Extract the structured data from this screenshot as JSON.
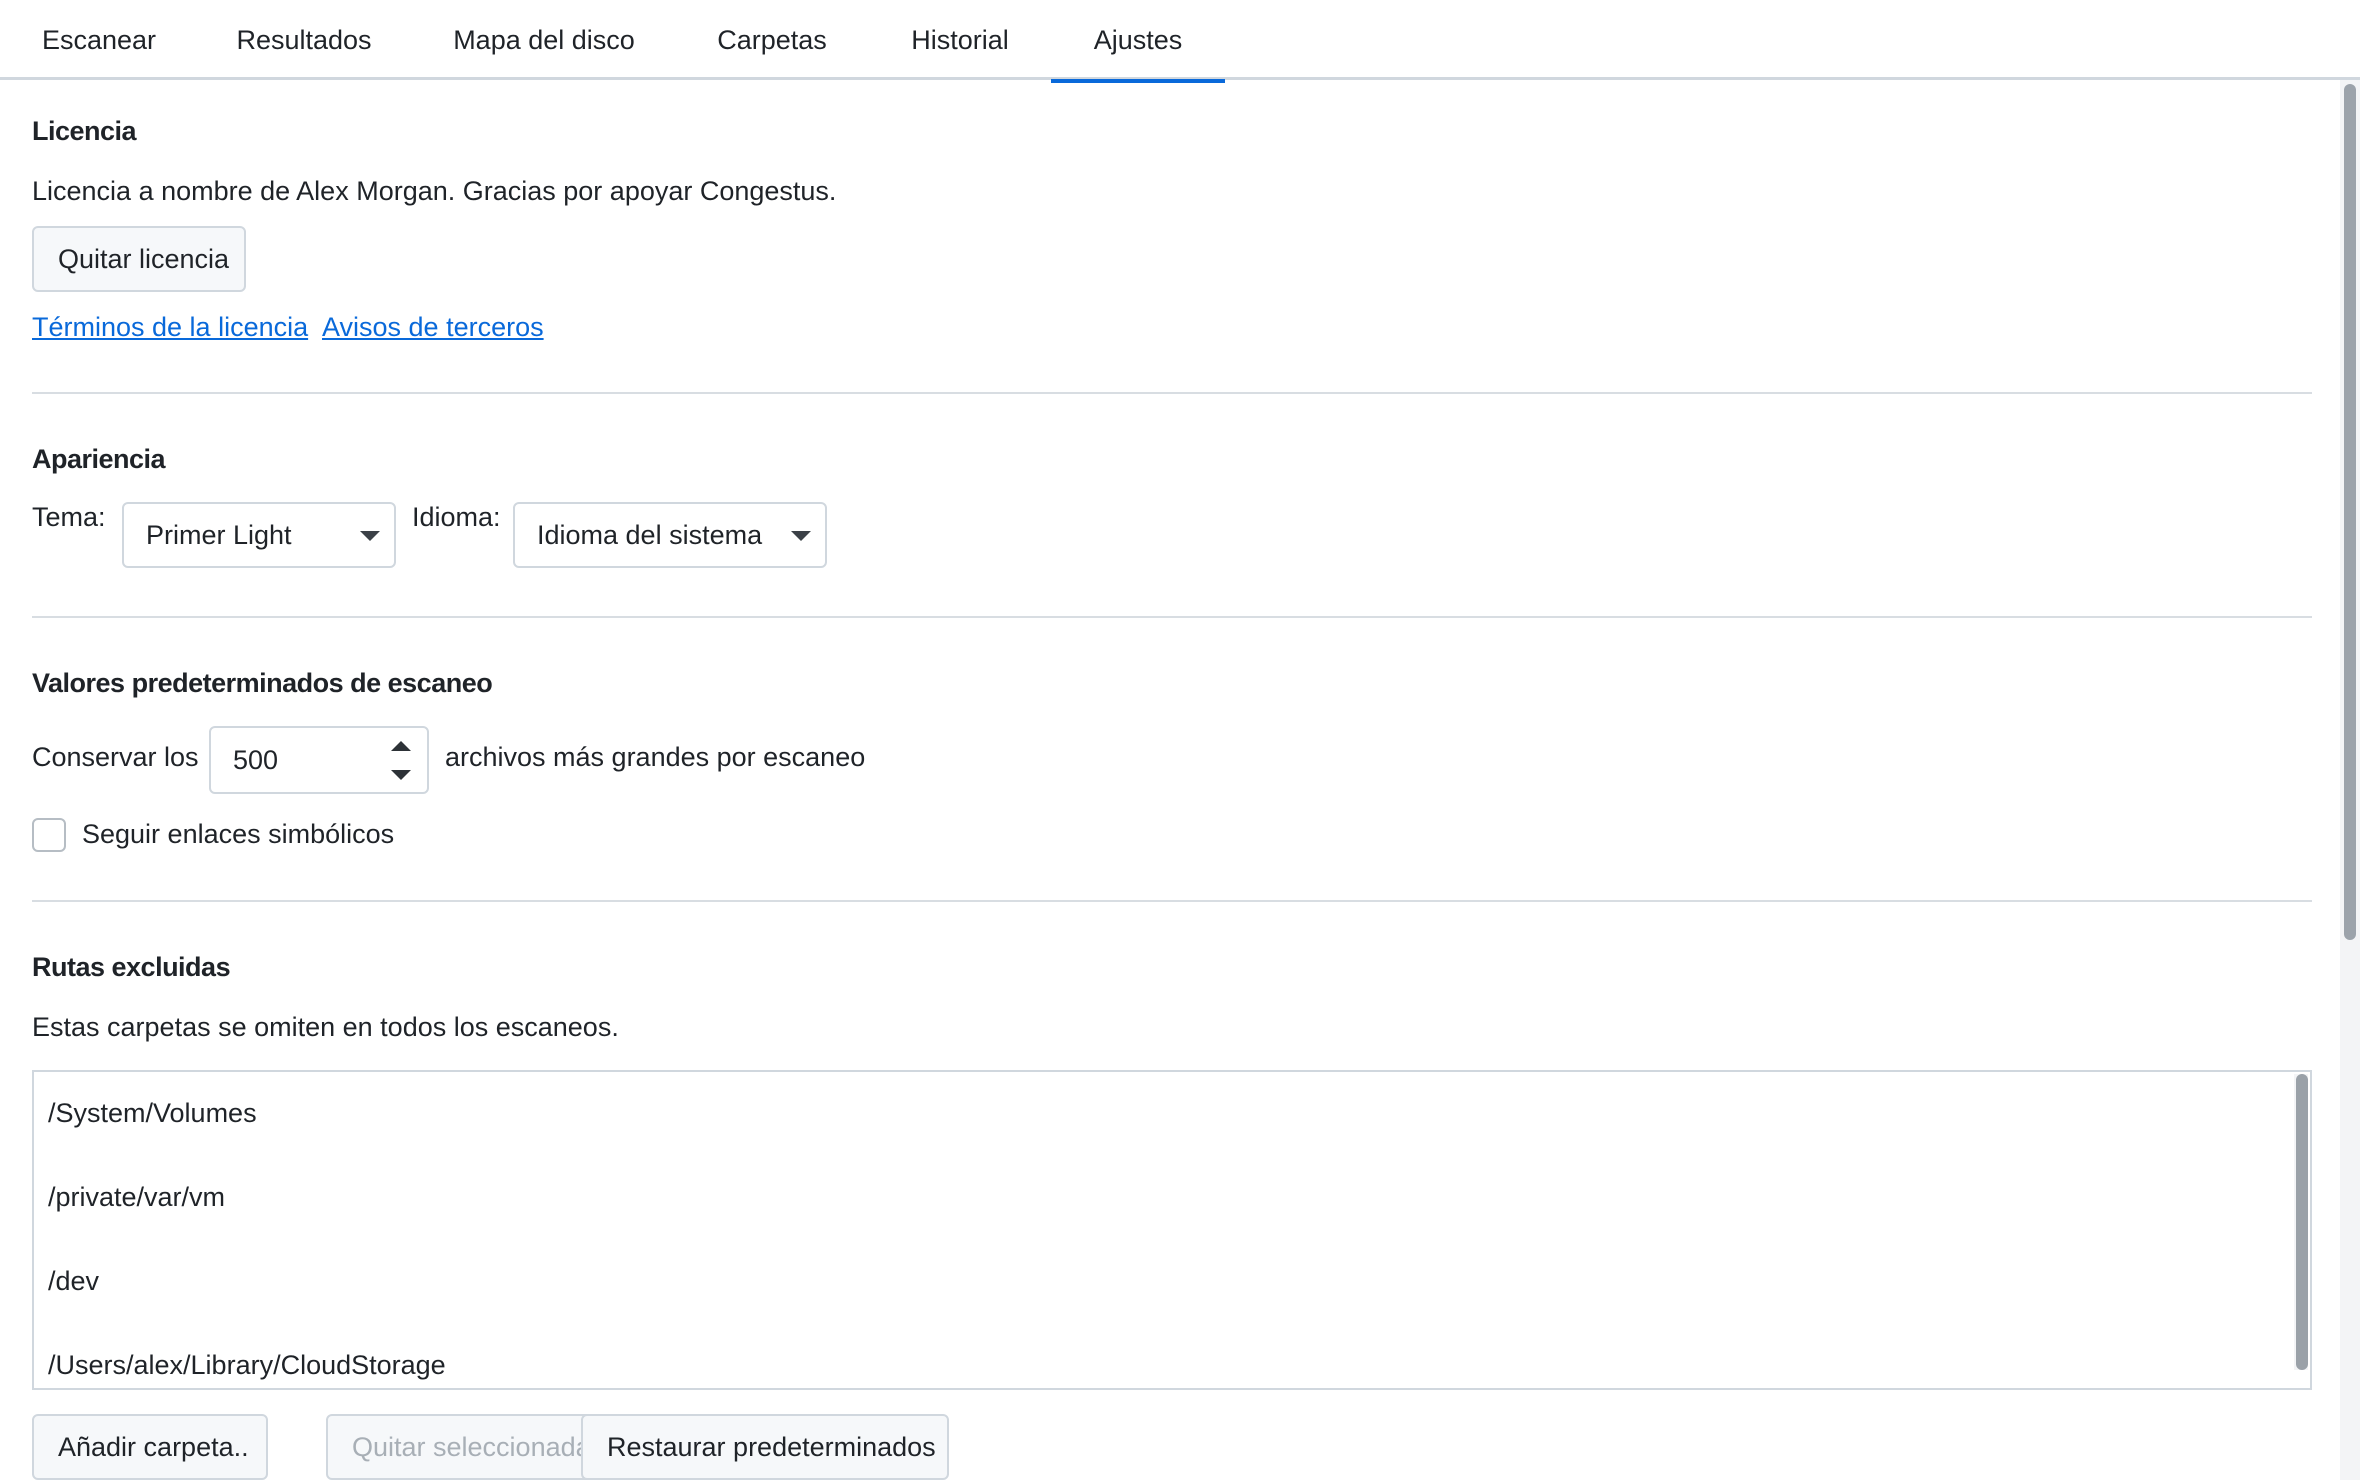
{
  "tabs": [
    {
      "label": "Escanear"
    },
    {
      "label": "Resultados"
    },
    {
      "label": "Mapa del disco"
    },
    {
      "label": "Carpetas"
    },
    {
      "label": "Historial"
    },
    {
      "label": "Ajustes",
      "active": true
    }
  ],
  "license": {
    "title": "Licencia",
    "text": "Licencia a nombre de Alex Morgan. Gracias por apoyar Congestus.",
    "remove_button": "Quitar licencia",
    "terms_link": "Términos de la licencia",
    "notices_link": "Avisos de terceros"
  },
  "appearance": {
    "title": "Apariencia",
    "theme_label": "Tema:",
    "theme_value": "Primer Light",
    "language_label": "Idioma:",
    "language_value": "Idioma del sistema"
  },
  "scan_defaults": {
    "title": "Valores predeterminados de escaneo",
    "keep_prefix": "Conservar los",
    "keep_value": "500",
    "keep_suffix": "archivos más grandes por escaneo",
    "symlinks_label": "Seguir enlaces simbólicos",
    "symlinks_checked": false
  },
  "excluded": {
    "title": "Rutas excluidas",
    "description": "Estas carpetas se omiten en todos los escaneos.",
    "paths": [
      "/System/Volumes",
      "/private/var/vm",
      "/dev",
      "/Users/alex/Library/CloudStorage"
    ],
    "add_button": "Añadir carpeta..",
    "remove_button": "Quitar seleccionada",
    "restore_button": "Restaurar predeterminados"
  },
  "colors": {
    "accent": "#0969da",
    "border": "#d0d7de",
    "text": "#1f2328"
  }
}
